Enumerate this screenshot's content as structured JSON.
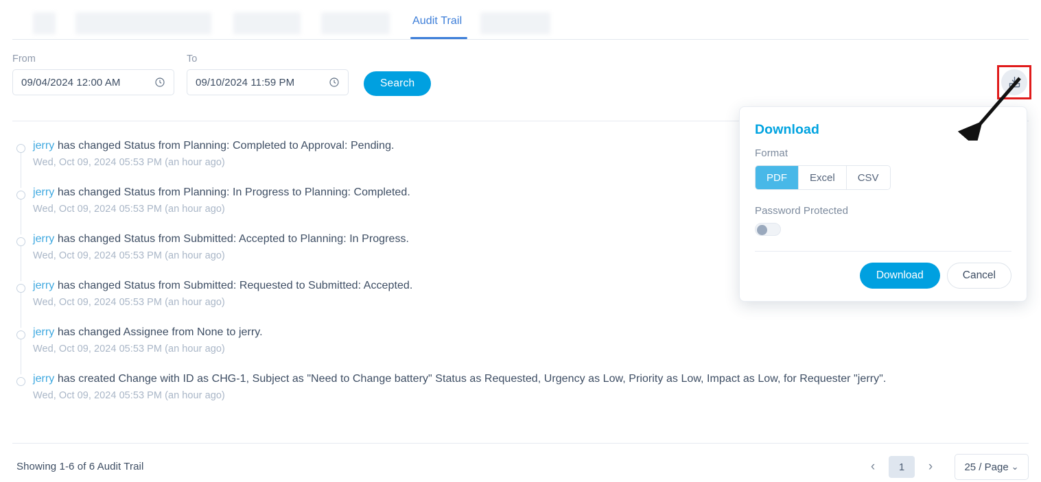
{
  "tabs": {
    "active_label": "Audit Trail",
    "redacted_count": 6
  },
  "filters": {
    "from_label": "From",
    "from_value": "09/04/2024 12:00 AM",
    "to_label": "To",
    "to_value": "09/10/2024 11:59 PM",
    "search_label": "Search",
    "clock_icon": "clock-icon"
  },
  "audit_entries": [
    {
      "user": "jerry",
      "text": " has changed Status from Planning: Completed to Approval: Pending.",
      "timestamp": "Wed, Oct 09, 2024 05:53 PM (an hour ago)"
    },
    {
      "user": "jerry",
      "text": " has changed Status from Planning: In Progress to Planning: Completed.",
      "timestamp": "Wed, Oct 09, 2024 05:53 PM (an hour ago)"
    },
    {
      "user": "jerry",
      "text": " has changed Status from Submitted: Accepted to Planning: In Progress.",
      "timestamp": "Wed, Oct 09, 2024 05:53 PM (an hour ago)"
    },
    {
      "user": "jerry",
      "text": " has changed Status from Submitted: Requested to Submitted: Accepted.",
      "timestamp": "Wed, Oct 09, 2024 05:53 PM (an hour ago)"
    },
    {
      "user": "jerry",
      "text": " has changed Assignee from None to jerry.",
      "timestamp": "Wed, Oct 09, 2024 05:53 PM (an hour ago)"
    },
    {
      "user": "jerry",
      "text": " has created Change with ID as CHG-1, Subject as \"Need to Change battery\" Status as Requested, Urgency as Low, Priority as Low, Impact as Low, for Requester \"jerry\".",
      "timestamp": "Wed, Oct 09, 2024 05:53 PM (an hour ago)"
    }
  ],
  "footer": {
    "showing": "Showing 1-6 of 6 Audit Trail",
    "prev_label": "‹",
    "page_number": "1",
    "next_label": "›",
    "page_size": "25 / Page",
    "page_size_caret": "⌄"
  },
  "download_button": {
    "icon": "download-tray-icon"
  },
  "popover": {
    "title": "Download",
    "format_label": "Format",
    "formats": [
      {
        "label": "PDF",
        "selected": true
      },
      {
        "label": "Excel",
        "selected": false
      },
      {
        "label": "CSV",
        "selected": false
      }
    ],
    "password_label": "Password Protected",
    "password_enabled": false,
    "download_label": "Download",
    "cancel_label": "Cancel"
  },
  "colors": {
    "accent_blue": "#00a0e0",
    "segment_active": "#48b8e8",
    "tab_active": "#3b7dd8",
    "link_blue": "#3ea8e0",
    "text_primary": "#3d4d63",
    "text_muted": "#a9b6c7",
    "annotation_red": "#e01b1b"
  }
}
